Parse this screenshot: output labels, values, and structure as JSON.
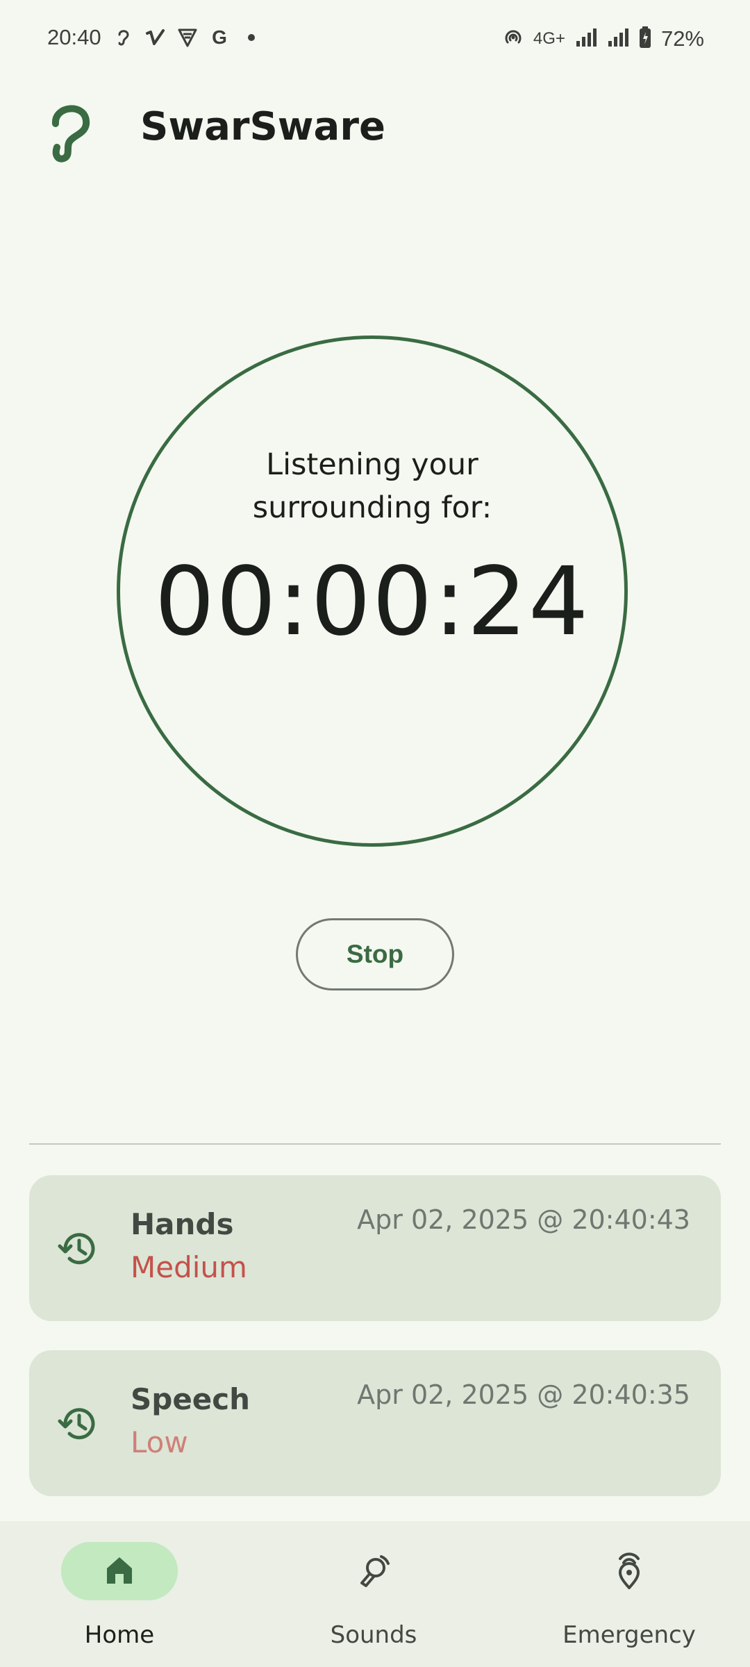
{
  "status_bar": {
    "time": "20:40",
    "left_icons": [
      "ear-icon",
      "vimeo-icon",
      "vpn-icon",
      "google-icon",
      "dot-icon"
    ],
    "google_glyph": "G",
    "network_label": "4G+",
    "battery_percent": "72%"
  },
  "app_bar": {
    "title": "SwarSware",
    "logo_icon": "ear-icon"
  },
  "timer": {
    "caption_line1": "Listening your",
    "caption_line2": "surrounding for:",
    "value": "00:00:24",
    "ring_color": "#3a6b43"
  },
  "controls": {
    "stop_label": "Stop"
  },
  "events": [
    {
      "name": "Hands",
      "level": "Medium",
      "timestamp": "Apr 02, 2025 @ 20:40:43",
      "icon": "history-icon",
      "level_color": "#c5514b"
    },
    {
      "name": "Speech",
      "level": "Low",
      "timestamp": "Apr 02, 2025 @ 20:40:35",
      "icon": "history-icon",
      "level_color": "#cf8078"
    }
  ],
  "bottom_nav": {
    "items": [
      {
        "label": "Home",
        "icon": "home-icon",
        "active": true
      },
      {
        "label": "Sounds",
        "icon": "sounds-icon",
        "active": false
      },
      {
        "label": "Emergency",
        "icon": "emergency-location-icon",
        "active": false
      }
    ]
  },
  "colors": {
    "background": "#f4f8f0",
    "accent": "#3a6b43",
    "card": "#dce5d6",
    "nav_active": "#c2e9c0"
  }
}
